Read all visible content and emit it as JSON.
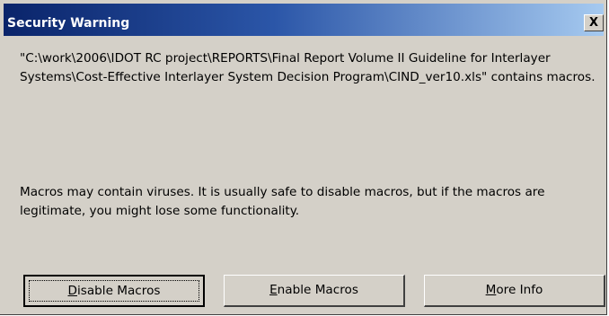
{
  "window": {
    "title": "Security Warning",
    "close_label": "X"
  },
  "message": {
    "file_text": "\"C:\\work\\2006\\IDOT RC project\\REPORTS\\Final Report Volume II Guideline for Interlayer Systems\\Cost-Effective Interlayer System Decision Program\\CIND_ver10.xls\" contains macros.",
    "warning_text": "Macros may contain viruses. It is usually safe to disable macros, but if the macros are legitimate, you might lose some functionality."
  },
  "buttons": [
    {
      "first": "D",
      "rest": "isable Macros"
    },
    {
      "first": "E",
      "rest": "nable Macros"
    },
    {
      "first": "M",
      "rest": "ore Info"
    }
  ]
}
